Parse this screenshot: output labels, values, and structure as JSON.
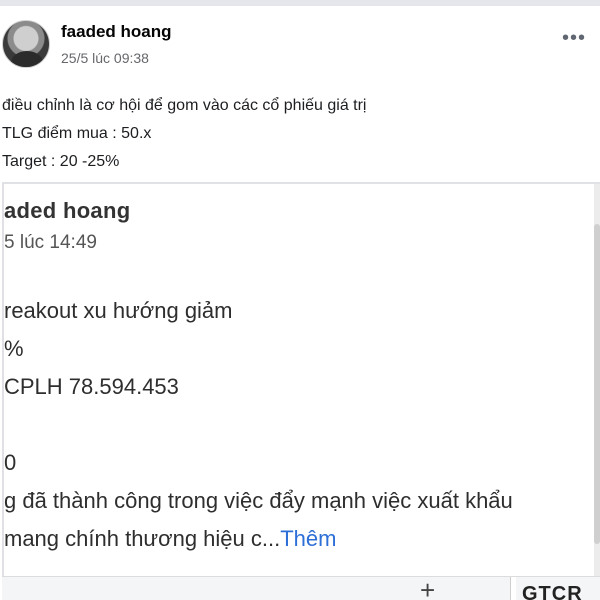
{
  "post": {
    "author": "faaded hoang",
    "timestamp": "25/5 lúc 09:38",
    "more_label": "•••",
    "lines": [
      "điều chỉnh là cơ hội để gom vào các cổ phiếu giá trị",
      "TLG điểm mua : 50.x",
      "Target : 20 -25%"
    ]
  },
  "shared_post": {
    "author": "aded hoang",
    "timestamp": "5 lúc 14:49",
    "lines": [
      "",
      "reakout xu hướng giảm",
      "%",
      "CPLH 78.594.453",
      "",
      "0",
      "g đã thành công trong việc đẩy mạnh việc xuất khẩu",
      "mang chính thương hiệu c..."
    ],
    "more_link": "Thêm"
  },
  "bottom_bar": {
    "plus": "+",
    "code": "GTCR"
  }
}
